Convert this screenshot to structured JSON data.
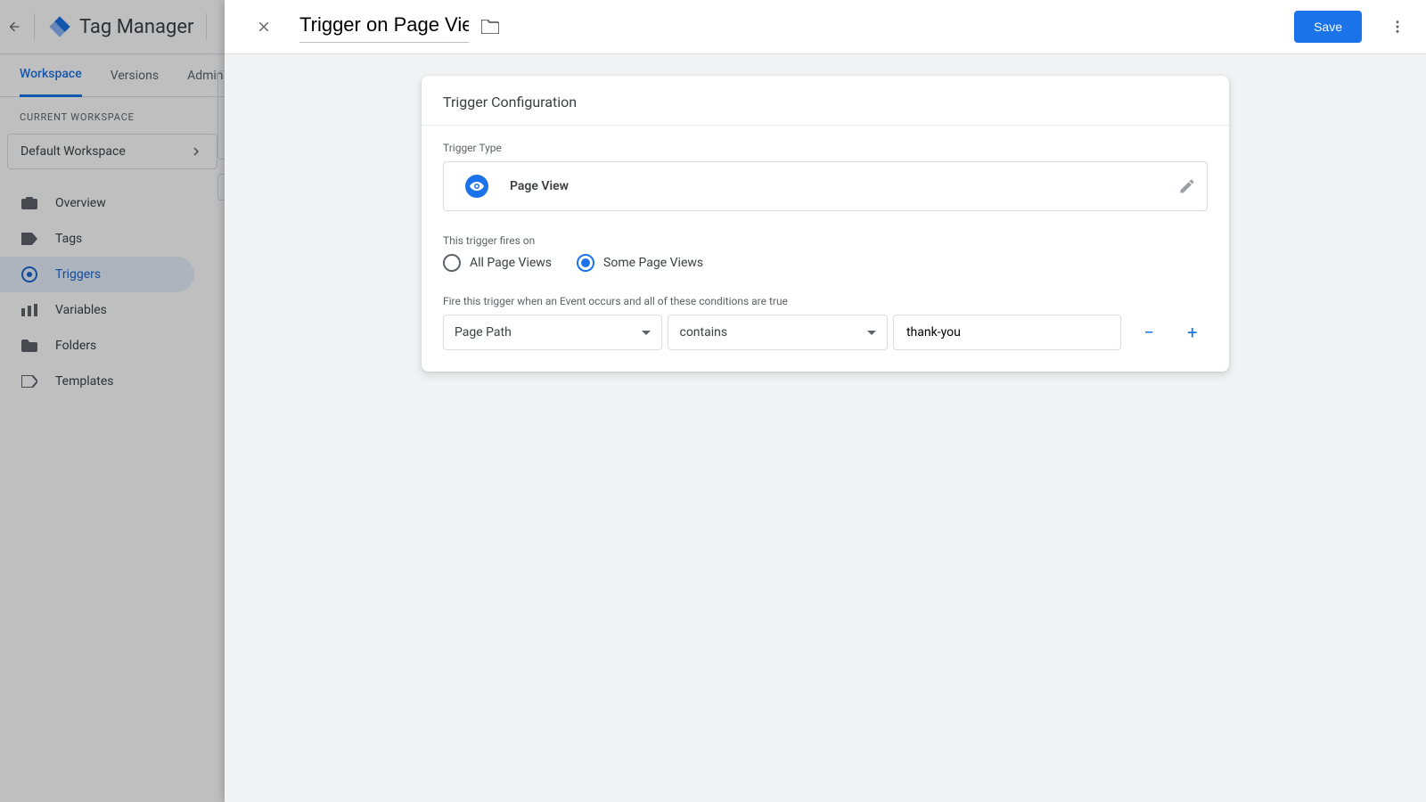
{
  "app": {
    "title": "Tag Manager"
  },
  "tabs": {
    "workspace": "Workspace",
    "versions": "Versions",
    "admin": "Admin"
  },
  "workspace": {
    "section_label": "CURRENT WORKSPACE",
    "current": "Default Workspace"
  },
  "nav": {
    "overview": "Overview",
    "tags": "Tags",
    "triggers": "Triggers",
    "variables": "Variables",
    "folders": "Folders",
    "templates": "Templates"
  },
  "panel": {
    "name": "Trigger on Page View",
    "save": "Save",
    "card_title": "Trigger Configuration",
    "trigger_type_label": "Trigger Type",
    "trigger_type_value": "Page View",
    "fires_label": "This trigger fires on",
    "radio_all": "All Page Views",
    "radio_some": "Some Page Views",
    "cond_label": "Fire this trigger when an Event occurs and all of these conditions are true",
    "cond_variable": "Page Path",
    "cond_operator": "contains",
    "cond_value": "thank-you"
  }
}
